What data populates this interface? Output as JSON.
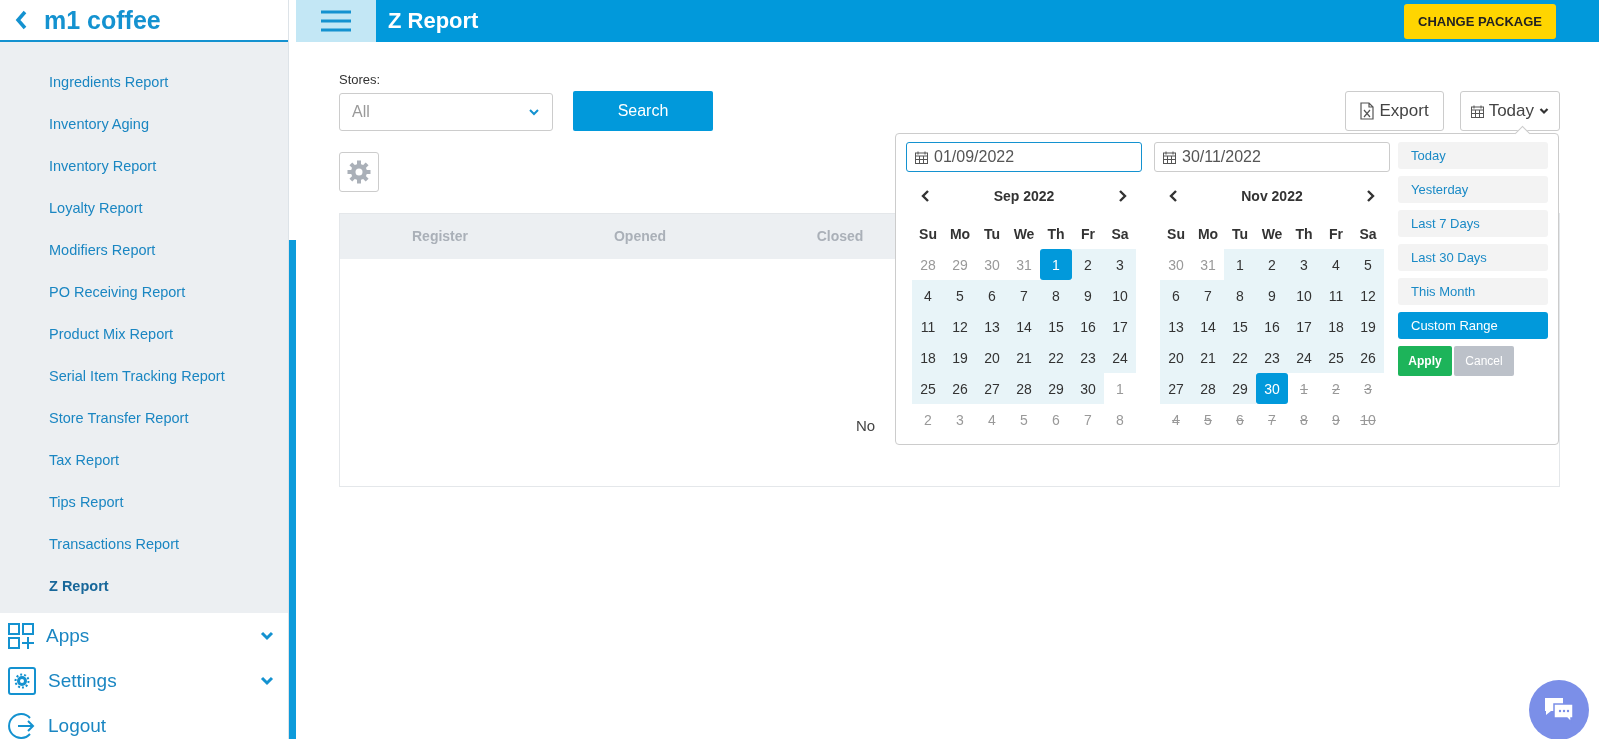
{
  "sidebar": {
    "brand": "m1 coffee",
    "items": [
      {
        "label": "Ingredients Report",
        "selected": false
      },
      {
        "label": "Inventory Aging",
        "selected": false
      },
      {
        "label": "Inventory Report",
        "selected": false
      },
      {
        "label": "Loyalty Report",
        "selected": false
      },
      {
        "label": "Modifiers Report",
        "selected": false
      },
      {
        "label": "PO Receiving Report",
        "selected": false
      },
      {
        "label": "Product Mix Report",
        "selected": false
      },
      {
        "label": "Serial Item Tracking Report",
        "selected": false
      },
      {
        "label": "Store Transfer Report",
        "selected": false
      },
      {
        "label": "Tax Report",
        "selected": false
      },
      {
        "label": "Tips Report",
        "selected": false
      },
      {
        "label": "Transactions Report",
        "selected": false
      },
      {
        "label": "Z Report",
        "selected": true
      }
    ],
    "nav": [
      {
        "label": "Apps",
        "kind": "apps",
        "expandable": true
      },
      {
        "label": "Settings",
        "kind": "settings",
        "expandable": true
      },
      {
        "label": "Logout",
        "kind": "logout",
        "expandable": false
      }
    ]
  },
  "header": {
    "title": "Z Report",
    "action": "CHANGE PACKAGE"
  },
  "filters": {
    "stores_label": "Stores:",
    "stores_placeholder": "All",
    "search_button": "Search",
    "export_button": "Export",
    "range_button": "Today"
  },
  "table": {
    "columns": [
      "Register",
      "Opened",
      "Closed"
    ],
    "empty_message": "No"
  },
  "date_picker": {
    "inputs": [
      {
        "value": "01/09/2022",
        "focused": true
      },
      {
        "value": "30/11/2022",
        "focused": false
      }
    ],
    "calendars": [
      {
        "month": "Sep 2022",
        "weekdays": [
          "Su",
          "Mo",
          "Tu",
          "We",
          "Th",
          "Fr",
          "Sa"
        ],
        "days": [
          {
            "d": "28",
            "kind": "off"
          },
          {
            "d": "29",
            "kind": "off"
          },
          {
            "d": "30",
            "kind": "off"
          },
          {
            "d": "31",
            "kind": "off"
          },
          {
            "d": "1",
            "kind": "start"
          },
          {
            "d": "2",
            "kind": "range"
          },
          {
            "d": "3",
            "kind": "range"
          },
          {
            "d": "4",
            "kind": "range"
          },
          {
            "d": "5",
            "kind": "range"
          },
          {
            "d": "6",
            "kind": "range"
          },
          {
            "d": "7",
            "kind": "range"
          },
          {
            "d": "8",
            "kind": "range"
          },
          {
            "d": "9",
            "kind": "range"
          },
          {
            "d": "10",
            "kind": "range"
          },
          {
            "d": "11",
            "kind": "range"
          },
          {
            "d": "12",
            "kind": "range"
          },
          {
            "d": "13",
            "kind": "range"
          },
          {
            "d": "14",
            "kind": "range"
          },
          {
            "d": "15",
            "kind": "range"
          },
          {
            "d": "16",
            "kind": "range"
          },
          {
            "d": "17",
            "kind": "range"
          },
          {
            "d": "18",
            "kind": "range"
          },
          {
            "d": "19",
            "kind": "range"
          },
          {
            "d": "20",
            "kind": "range"
          },
          {
            "d": "21",
            "kind": "range"
          },
          {
            "d": "22",
            "kind": "range"
          },
          {
            "d": "23",
            "kind": "range"
          },
          {
            "d": "24",
            "kind": "range"
          },
          {
            "d": "25",
            "kind": "range"
          },
          {
            "d": "26",
            "kind": "range"
          },
          {
            "d": "27",
            "kind": "range"
          },
          {
            "d": "28",
            "kind": "range"
          },
          {
            "d": "29",
            "kind": "range"
          },
          {
            "d": "30",
            "kind": "range"
          },
          {
            "d": "1",
            "kind": "off"
          },
          {
            "d": "2",
            "kind": "off"
          },
          {
            "d": "3",
            "kind": "off"
          },
          {
            "d": "4",
            "kind": "off"
          },
          {
            "d": "5",
            "kind": "off"
          },
          {
            "d": "6",
            "kind": "off"
          },
          {
            "d": "7",
            "kind": "off"
          },
          {
            "d": "8",
            "kind": "off"
          }
        ]
      },
      {
        "month": "Nov 2022",
        "weekdays": [
          "Su",
          "Mo",
          "Tu",
          "We",
          "Th",
          "Fr",
          "Sa"
        ],
        "days": [
          {
            "d": "30",
            "kind": "off"
          },
          {
            "d": "31",
            "kind": "off"
          },
          {
            "d": "1",
            "kind": "range"
          },
          {
            "d": "2",
            "kind": "range"
          },
          {
            "d": "3",
            "kind": "range"
          },
          {
            "d": "4",
            "kind": "range"
          },
          {
            "d": "5",
            "kind": "range"
          },
          {
            "d": "6",
            "kind": "range"
          },
          {
            "d": "7",
            "kind": "range"
          },
          {
            "d": "8",
            "kind": "range"
          },
          {
            "d": "9",
            "kind": "range"
          },
          {
            "d": "10",
            "kind": "range"
          },
          {
            "d": "11",
            "kind": "range"
          },
          {
            "d": "12",
            "kind": "range"
          },
          {
            "d": "13",
            "kind": "range"
          },
          {
            "d": "14",
            "kind": "range"
          },
          {
            "d": "15",
            "kind": "range"
          },
          {
            "d": "16",
            "kind": "range"
          },
          {
            "d": "17",
            "kind": "range"
          },
          {
            "d": "18",
            "kind": "range"
          },
          {
            "d": "19",
            "kind": "range"
          },
          {
            "d": "20",
            "kind": "range"
          },
          {
            "d": "21",
            "kind": "range"
          },
          {
            "d": "22",
            "kind": "range"
          },
          {
            "d": "23",
            "kind": "range"
          },
          {
            "d": "24",
            "kind": "range"
          },
          {
            "d": "25",
            "kind": "range"
          },
          {
            "d": "26",
            "kind": "range"
          },
          {
            "d": "27",
            "kind": "range"
          },
          {
            "d": "28",
            "kind": "range"
          },
          {
            "d": "29",
            "kind": "range"
          },
          {
            "d": "30",
            "kind": "end"
          },
          {
            "d": "1",
            "kind": "disabled"
          },
          {
            "d": "2",
            "kind": "disabled"
          },
          {
            "d": "3",
            "kind": "disabled"
          },
          {
            "d": "4",
            "kind": "disabled"
          },
          {
            "d": "5",
            "kind": "disabled"
          },
          {
            "d": "6",
            "kind": "disabled"
          },
          {
            "d": "7",
            "kind": "disabled"
          },
          {
            "d": "8",
            "kind": "disabled"
          },
          {
            "d": "9",
            "kind": "disabled"
          },
          {
            "d": "10",
            "kind": "disabled"
          }
        ]
      }
    ],
    "ranges": [
      {
        "label": "Today",
        "selected": false
      },
      {
        "label": "Yesterday",
        "selected": false
      },
      {
        "label": "Last 7 Days",
        "selected": false
      },
      {
        "label": "Last 30 Days",
        "selected": false
      },
      {
        "label": "This Month",
        "selected": false
      },
      {
        "label": "Custom Range",
        "selected": true
      }
    ],
    "apply": "Apply",
    "cancel": "Cancel"
  }
}
